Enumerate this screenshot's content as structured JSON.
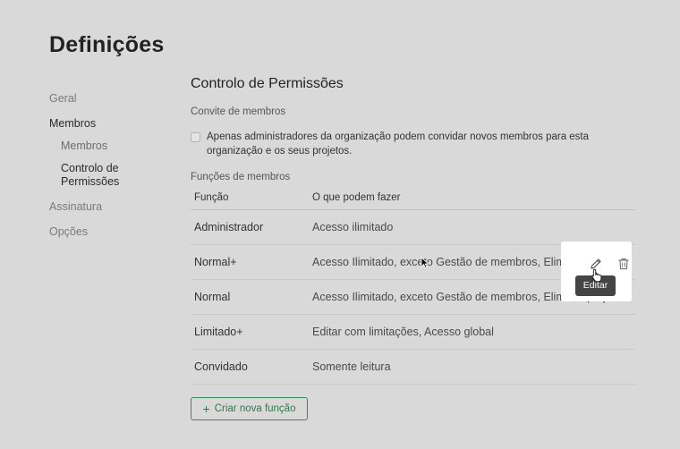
{
  "page": {
    "title": "Definições"
  },
  "sidebar": {
    "items": [
      {
        "label": "Geral"
      },
      {
        "label": "Membros"
      },
      {
        "label": "Assinatura"
      },
      {
        "label": "Opções"
      }
    ],
    "sub_items": [
      {
        "label": "Membros"
      },
      {
        "label": "Controlo de Permissões"
      }
    ]
  },
  "main": {
    "title": "Controlo de Permissões",
    "invite_section": "Convite de membros",
    "invite_checkbox_label": "Apenas administradores da organização podem convidar novos membros para esta organização e os seus projetos.",
    "invite_checkbox_checked": false,
    "roles_section": "Funções de membros",
    "table": {
      "headers": [
        "Função",
        "O que podem fazer"
      ],
      "rows": [
        {
          "role": "Administrador",
          "permissions": "Acesso ilimitado"
        },
        {
          "role": "Normal+",
          "permissions": "Acesso Ilimitado, exceto Gestão de membros, Eliminar projetos"
        },
        {
          "role": "Normal",
          "permissions": "Acesso Ilimitado, exceto Gestão de membros, Eliminar projetos"
        },
        {
          "role": "Limitado+",
          "permissions": "Editar com limitações, Acesso global"
        },
        {
          "role": "Convidado",
          "permissions": "Somente leitura"
        }
      ]
    },
    "row_actions": {
      "tooltip": "Editar",
      "edit_icon": "pencil-icon",
      "delete_icon": "trash-icon"
    },
    "new_role_button": {
      "icon": "plus-icon",
      "label": "Criar nova função"
    }
  },
  "colors": {
    "background": "#d9d9d9",
    "accent": "#2f7a4b",
    "tooltip": "#444444"
  }
}
